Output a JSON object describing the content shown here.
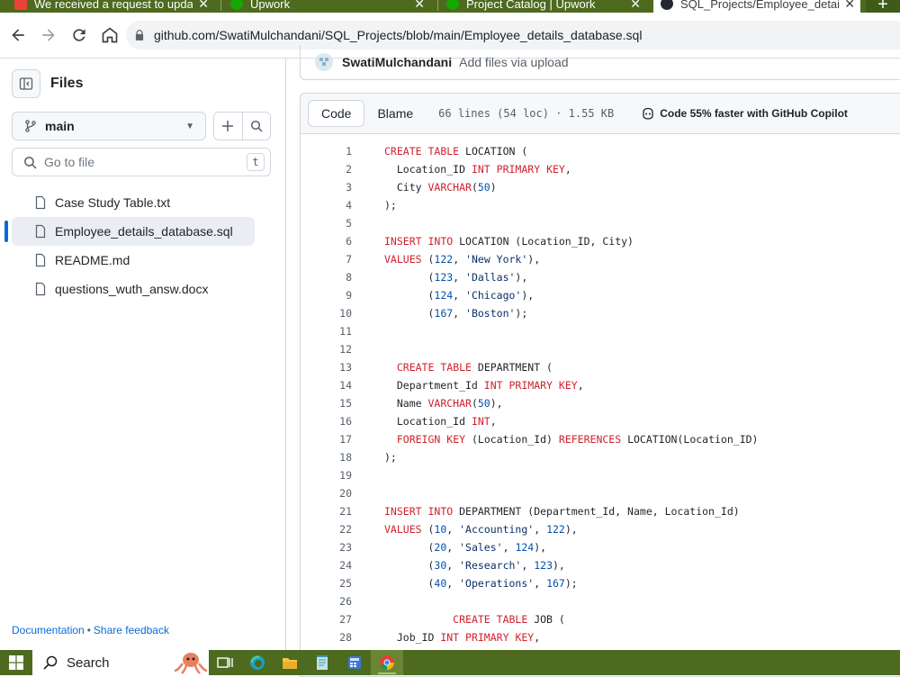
{
  "browser": {
    "tabs": [
      {
        "title": "We received a request to update",
        "favicon": "gmail-icon"
      },
      {
        "title": "Upwork",
        "favicon": "upwork-icon"
      },
      {
        "title": "Project Catalog | Upwork",
        "favicon": "upwork-icon"
      },
      {
        "title": "SQL_Projects/Employee_details_d",
        "favicon": "github-icon",
        "active": true
      }
    ],
    "url": "github.com/SwatiMulchandani/SQL_Projects/blob/main/Employee_details_database.sql"
  },
  "sidebar": {
    "title": "Files",
    "branch": "main",
    "goto_placeholder": "Go to file",
    "goto_shortcut": "t",
    "files": [
      {
        "name": "Case Study Table.txt"
      },
      {
        "name": "Employee_details_database.sql",
        "selected": true
      },
      {
        "name": "README.md"
      },
      {
        "name": "questions_wuth_answ.docx"
      }
    ],
    "footer": {
      "docs": "Documentation",
      "sep": "•",
      "feedback": "Share feedback"
    }
  },
  "commit": {
    "author": "SwatiMulchandani",
    "message": "Add files via upload"
  },
  "file_header": {
    "code_tab": "Code",
    "blame_tab": "Blame",
    "meta": "66 lines (54 loc) · 1.55 KB",
    "copilot": "Code 55% faster with GitHub Copilot"
  },
  "code_lines": [
    "CREATE TABLE LOCATION (",
    "  Location_ID INT PRIMARY KEY,",
    "  City VARCHAR(50)",
    ");",
    "",
    "INSERT INTO LOCATION (Location_ID, City)",
    "VALUES (122, 'New York'),",
    "       (123, 'Dallas'),",
    "       (124, 'Chicago'),",
    "       (167, 'Boston');",
    "",
    "",
    "  CREATE TABLE DEPARTMENT (",
    "  Department_Id INT PRIMARY KEY,",
    "  Name VARCHAR(50),",
    "  Location_Id INT,",
    "  FOREIGN KEY (Location_Id) REFERENCES LOCATION(Location_ID)",
    ");",
    "",
    "",
    "INSERT INTO DEPARTMENT (Department_Id, Name, Location_Id)",
    "VALUES (10, 'Accounting', 122),",
    "       (20, 'Sales', 124),",
    "       (30, 'Research', 123),",
    "       (40, 'Operations', 167);",
    "",
    "           CREATE TABLE JOB (",
    "  Job_ID INT PRIMARY KEY,"
  ],
  "taskbar": {
    "search_label": "Search"
  },
  "colors": {
    "accent": "#0969da",
    "chrome": "#4d6a1f",
    "keyword": "#cf222e",
    "string": "#0a3069",
    "number": "#0550ae"
  }
}
